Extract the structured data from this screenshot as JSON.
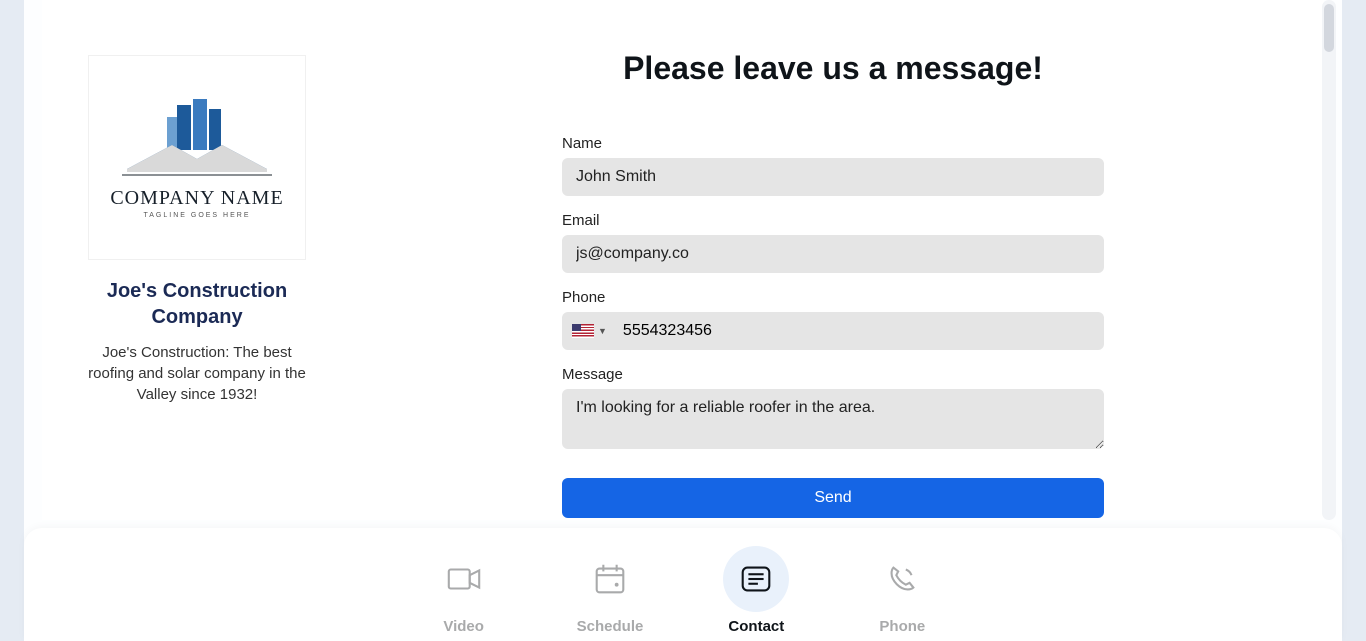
{
  "logo": {
    "text": "COMPANY NAME",
    "tagline": "TAGLINE GOES HERE"
  },
  "company": {
    "name": "Joe's Construction Company",
    "description": "Joe's Construction: The best roofing and solar company in the Valley since 1932!"
  },
  "form": {
    "title": "Please leave us a message!",
    "name_label": "Name",
    "name_value": "John Smith",
    "email_label": "Email",
    "email_value": "js@company.co",
    "phone_label": "Phone",
    "phone_value": "5554323456",
    "message_label": "Message",
    "message_value": "I'm looking for a reliable roofer in the area.",
    "send_label": "Send"
  },
  "nav": {
    "video": "Video",
    "schedule": "Schedule",
    "contact": "Contact",
    "phone": "Phone",
    "active": "contact"
  }
}
